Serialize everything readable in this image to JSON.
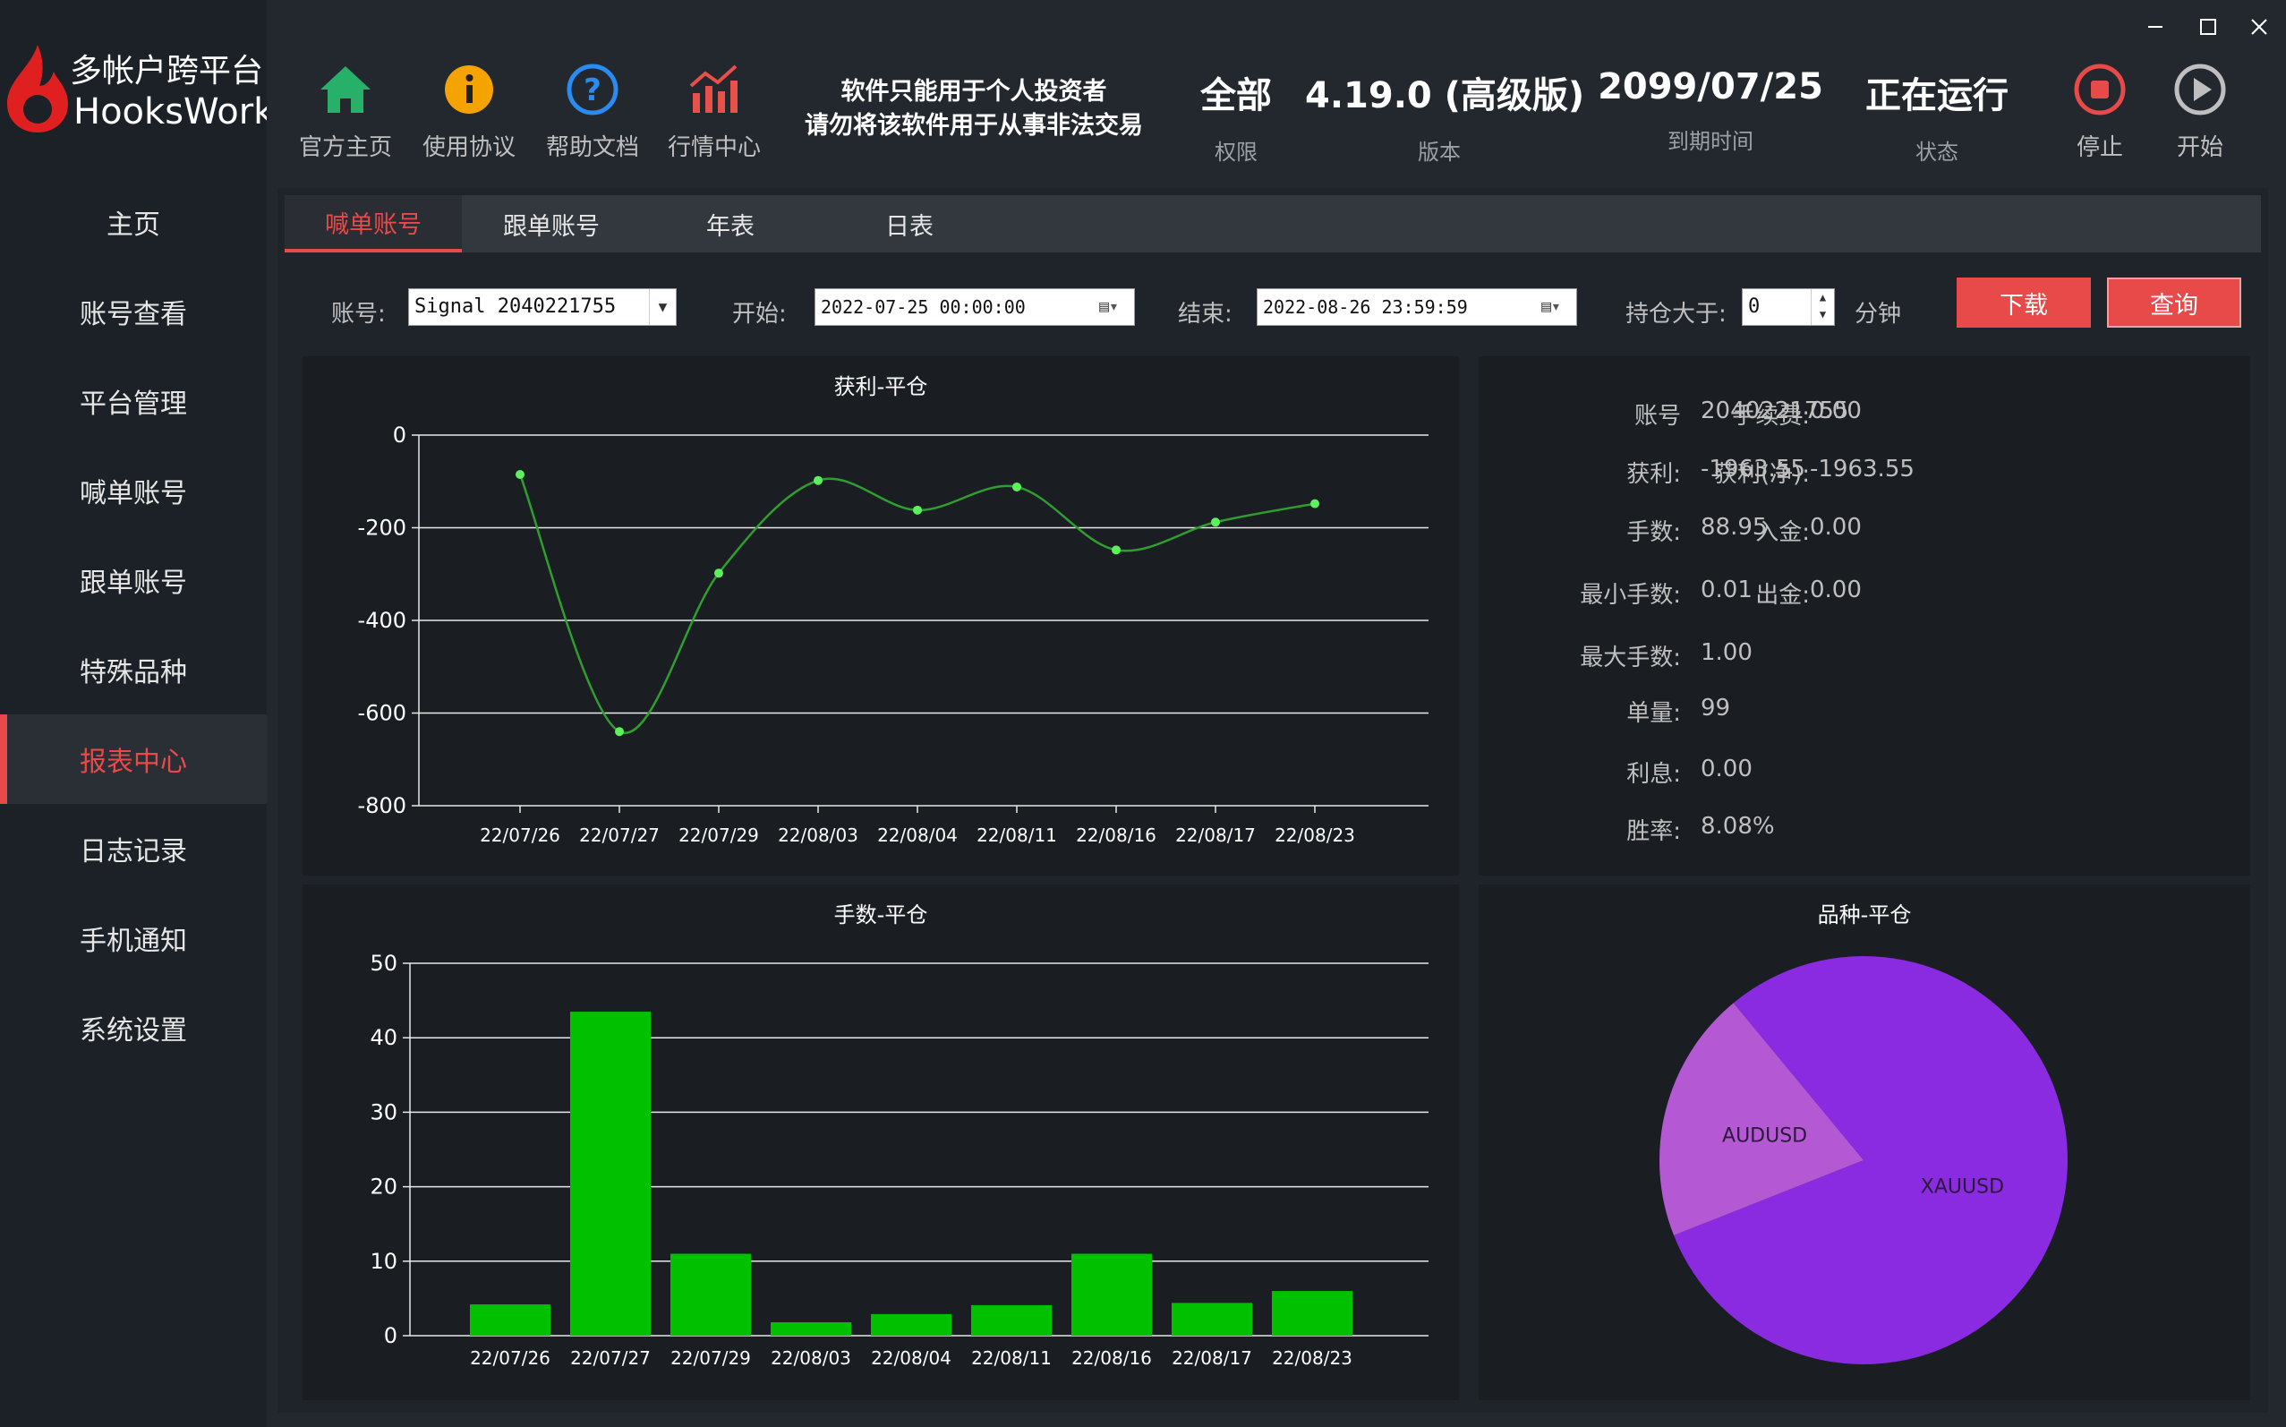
{
  "app": {
    "logo_line1": "多帐户跨平台",
    "logo_line2": "HooksWork"
  },
  "toolbar": {
    "buttons": [
      {
        "label": "官方主页",
        "icon": "home-icon"
      },
      {
        "label": "使用协议",
        "icon": "info-icon"
      },
      {
        "label": "帮助文档",
        "icon": "help-icon"
      },
      {
        "label": "行情中心",
        "icon": "market-chart-icon"
      }
    ],
    "notice_line1": "软件只能用于个人投资者",
    "notice_line2": "请勿将该软件用于从事非法交易",
    "permission_value": "全部",
    "permission_label": "权限",
    "version_value": "4.19.0 (高级版)",
    "version_label": "版本",
    "expiry_value": "2099/07/25",
    "expiry_label": "到期时间",
    "status_value": "正在运行",
    "status_label": "状态",
    "stop_label": "停止",
    "start_label": "开始"
  },
  "sidebar": {
    "items": [
      {
        "label": "主页"
      },
      {
        "label": "账号查看"
      },
      {
        "label": "平台管理"
      },
      {
        "label": "喊单账号"
      },
      {
        "label": "跟单账号"
      },
      {
        "label": "特殊品种"
      },
      {
        "label": "报表中心",
        "active": true
      },
      {
        "label": "日志记录"
      },
      {
        "label": "手机通知"
      },
      {
        "label": "系统设置"
      }
    ]
  },
  "tabs": [
    {
      "label": "喊单账号",
      "active": true
    },
    {
      "label": "跟单账号"
    },
    {
      "label": "年表"
    },
    {
      "label": "日表"
    }
  ],
  "filters": {
    "account_label": "账号:",
    "account_value": "Signal 2040221755",
    "start_label": "开始:",
    "start_value": "2022-07-25 00:00:00",
    "end_label": "结束:",
    "end_value": "2022-08-26 23:59:59",
    "hold_label": "持仓大于:",
    "hold_value": "0",
    "hold_unit": "分钟",
    "download_label": "下载",
    "query_label": "查询"
  },
  "stats": {
    "left": [
      {
        "key": "账号",
        "value": "2040221755"
      },
      {
        "key": "获利:",
        "value": "-1963.55"
      },
      {
        "key": "手数:",
        "value": "88.95"
      },
      {
        "key": "最小手数:",
        "value": "0.01"
      },
      {
        "key": "最大手数:",
        "value": "1.00"
      },
      {
        "key": "单量:",
        "value": "99"
      },
      {
        "key": "利息:",
        "value": "0.00"
      },
      {
        "key": "胜率:",
        "value": "8.08%"
      }
    ],
    "right": [
      {
        "key": "手续费:",
        "value": "0.00"
      },
      {
        "key": "获利(净):",
        "value": "-1963.55"
      },
      {
        "key": "入金:",
        "value": "0.00"
      },
      {
        "key": "出金:",
        "value": "0.00"
      }
    ]
  },
  "colors": {
    "accent": "#e84a4a",
    "line": "#2e9e2e",
    "point": "#5cf05c",
    "bar": "#00c000",
    "pie_xauusd": "#8a2be2",
    "pie_audusd": "#b558d4"
  },
  "chart_data": [
    {
      "type": "line",
      "title": "获利-平仓",
      "categories": [
        "22/07/26",
        "22/07/27",
        "22/07/29",
        "22/08/03",
        "22/08/04",
        "22/08/11",
        "22/08/16",
        "22/08/17",
        "22/08/23"
      ],
      "values": [
        -85,
        -640,
        -298,
        -98,
        -162,
        -112,
        -248,
        -188,
        -148
      ],
      "ylim": [
        -800,
        0
      ],
      "yticks": [
        0,
        -200,
        -400,
        -600,
        -800
      ],
      "grid": true
    },
    {
      "type": "bar",
      "title": "手数-平仓",
      "categories": [
        "22/07/26",
        "22/07/27",
        "22/07/29",
        "22/08/03",
        "22/08/04",
        "22/08/11",
        "22/08/16",
        "22/08/17",
        "22/08/23"
      ],
      "values": [
        4.2,
        43.5,
        11.0,
        1.8,
        2.9,
        4.1,
        11.0,
        4.4,
        6.0
      ],
      "ylim": [
        0,
        50
      ],
      "yticks": [
        50,
        40,
        30,
        20,
        10,
        0
      ],
      "grid": true
    },
    {
      "type": "pie",
      "title": "品种-平仓",
      "slices": [
        {
          "label": "XAUUSD",
          "value": 0.8,
          "color": "#8a2be2"
        },
        {
          "label": "AUDUSD",
          "value": 0.2,
          "color": "#b558d4"
        }
      ]
    }
  ]
}
